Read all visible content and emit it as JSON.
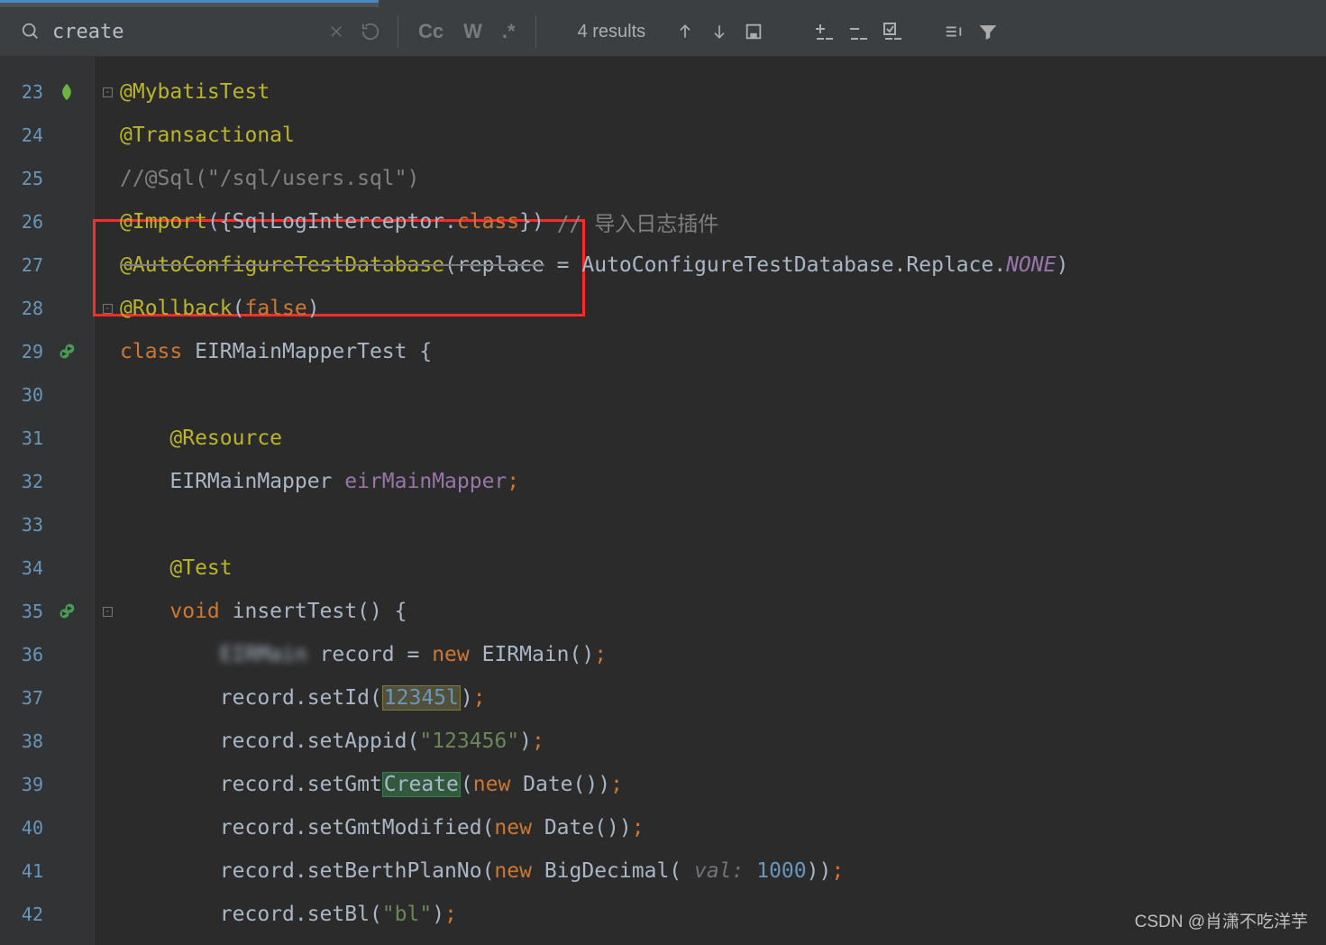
{
  "findbar": {
    "query": "create",
    "results_label": "4 results",
    "match_case_label": "Cc",
    "words_label": "W",
    "regex_label": ".*"
  },
  "gutter": {
    "lines": [
      "23",
      "24",
      "25",
      "26",
      "27",
      "28",
      "29",
      "30",
      "31",
      "32",
      "33",
      "34",
      "35",
      "36",
      "37",
      "38",
      "39",
      "40",
      "41",
      "42"
    ]
  },
  "code": {
    "l23_ann": "@MybatisTest",
    "l24_ann": "@Transactional",
    "l25_comment": "//@Sql(\"/sql/users.sql\")",
    "l26_ann": "@Import",
    "l26_open": "({SqlLogInterceptor.",
    "l26_class": "class",
    "l26_close": "}) ",
    "l26_comment": "// 导入日志插件",
    "l27_ann": "@AutoConfigureTestDatabase",
    "l27_open": "(",
    "l27_arg": "replace",
    "l27_eq": " = AutoConfigureTestDatabase.Replace.",
    "l27_none": "NONE",
    "l27_close": ")",
    "l28_ann": "@Rollback",
    "l28_open": "(",
    "l28_val": "false",
    "l28_close": ")",
    "l29_kw": "class",
    "l29_rest": " EIRMainMapperTest {",
    "l31_ann": "@Resource",
    "l32_type": "EIRMainMapper ",
    "l32_field": "eirMainMapper",
    "l32_semi": ";",
    "l34_ann": "@Test",
    "l35_kw": "void",
    "l35_rest": " insertTest() {",
    "l36_blur": "EIRMain",
    "l36_rest1": " record = ",
    "l36_new": "new",
    "l36_rest2": " EIRMain()",
    "l36_semi": ";",
    "l37_a": "record.setId(",
    "l37_num": "12345l",
    "l37_b": ")",
    "l37_semi": ";",
    "l38_a": "record.setAppid(",
    "l38_str": "\"123456\"",
    "l38_b": ")",
    "l38_semi": ";",
    "l39_a": "record.setGmt",
    "l39_hl": "Create",
    "l39_b": "(",
    "l39_new": "new",
    "l39_c": " Date())",
    "l39_semi": ";",
    "l40_a": "record.setGmtModified(",
    "l40_new": "new",
    "l40_b": " Date())",
    "l40_semi": ";",
    "l41_a": "record.setBerthPlanNo(",
    "l41_new": "new",
    "l41_b": " BigDecimal( ",
    "l41_param": "val:",
    "l41_sp": " ",
    "l41_num": "1000",
    "l41_c": "))",
    "l41_semi": ";",
    "l42_a": "record.setBl(",
    "l42_str": "\"bl\"",
    "l42_b": ")",
    "l42_semi": ";"
  },
  "watermark": "CSDN @肖潇不吃洋芋"
}
